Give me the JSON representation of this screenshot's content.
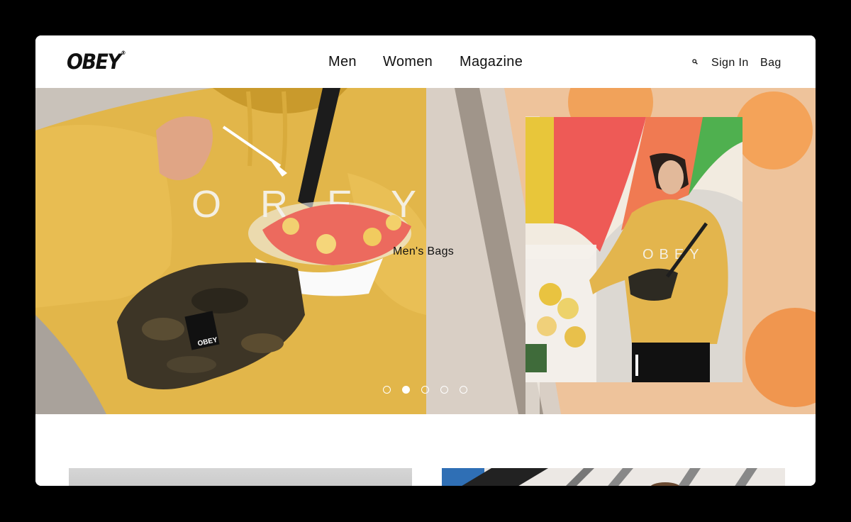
{
  "brand": {
    "logo": "OBEY",
    "mark": "®"
  },
  "nav": {
    "men": "Men",
    "women": "Women",
    "magazine": "Magazine"
  },
  "utility": {
    "sign_in": "Sign In",
    "bag": "Bag",
    "search_icon": "search-icon"
  },
  "hero": {
    "caption": "Men's Bags",
    "slides": 5,
    "active_slide": 2,
    "left_image": "man in yellow OBEY hoodie with camo fanny pack holding fruit cup",
    "right_image": "man in yellow hoodie at fruit stand under rainbow umbrella"
  },
  "colors": {
    "accent_yellow": "#e6b546",
    "hoodie_text": "#f4efe2"
  }
}
